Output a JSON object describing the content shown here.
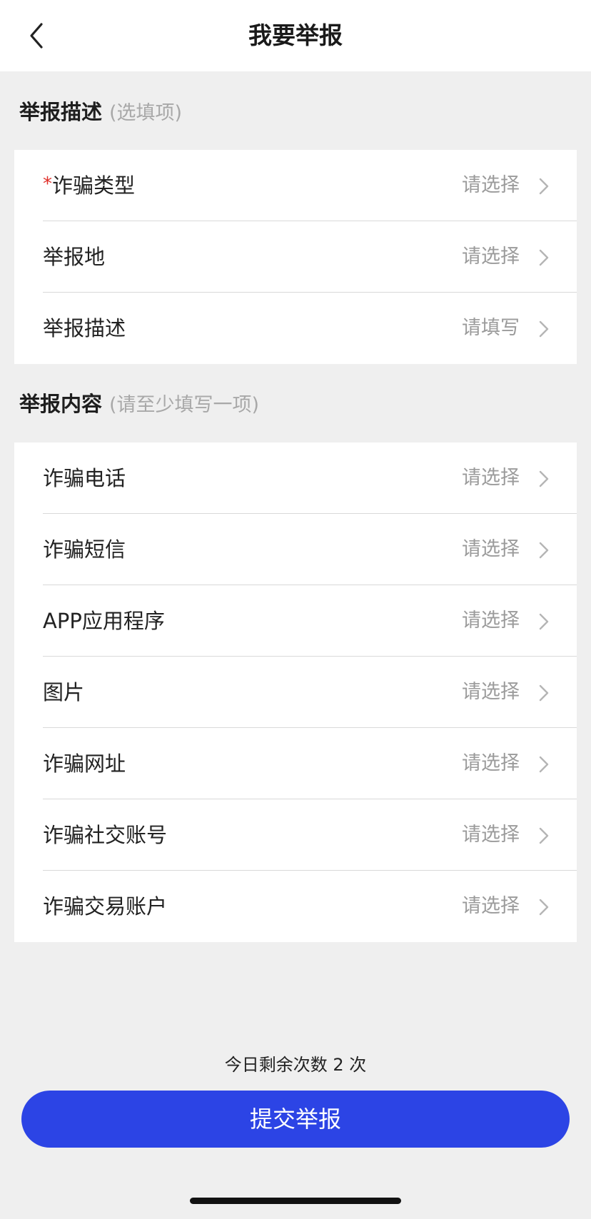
{
  "header": {
    "title": "我要举报",
    "back_icon": "chevron-left-icon"
  },
  "section_description": {
    "title": "举报描述",
    "hint": "(选填项)",
    "rows": [
      {
        "label": "诈骗类型",
        "required_mark": "*",
        "value": "请选择"
      },
      {
        "label": "举报地",
        "value": "请选择"
      },
      {
        "label": "举报描述",
        "value": "请填写"
      }
    ]
  },
  "section_content": {
    "title": "举报内容",
    "hint": "(请至少填写一项)",
    "rows": [
      {
        "label": "诈骗电话",
        "value": "请选择"
      },
      {
        "label": "诈骗短信",
        "value": "请选择"
      },
      {
        "label": "APP应用程序",
        "value": "请选择"
      },
      {
        "label": "图片",
        "value": "请选择"
      },
      {
        "label": "诈骗网址",
        "value": "请选择"
      },
      {
        "label": "诈骗社交账号",
        "value": "请选择"
      },
      {
        "label": "诈骗交易账户",
        "value": "请选择"
      }
    ]
  },
  "footer": {
    "remaining": "今日剩余次数 2 次",
    "submit_label": "提交举报"
  },
  "colors": {
    "accent": "#2c44e5",
    "required": "#e0302a",
    "placeholder": "#9b9b9b",
    "background": "#efefef"
  }
}
